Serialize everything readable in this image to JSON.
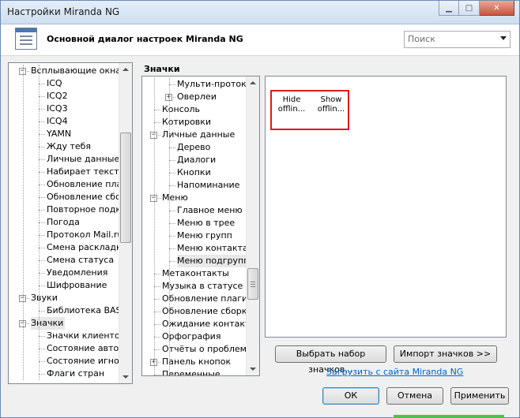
{
  "window": {
    "title": "Настройки Miranda NG"
  },
  "header": {
    "title": "Основной диалог настроек Miranda NG",
    "search_placeholder": "Поиск"
  },
  "left_tree": {
    "items": [
      {
        "label": "Всплывающие окна",
        "level": 0,
        "expander": "−"
      },
      {
        "label": "ICQ",
        "level": 1
      },
      {
        "label": "ICQ2",
        "level": 1
      },
      {
        "label": "ICQ3",
        "level": 1
      },
      {
        "label": "ICQ4",
        "level": 1
      },
      {
        "label": "YAMN",
        "level": 1
      },
      {
        "label": "Жду тебя",
        "level": 1
      },
      {
        "label": "Личные данные",
        "level": 1
      },
      {
        "label": "Набирает текст",
        "level": 1
      },
      {
        "label": "Обновление плагинов",
        "level": 1
      },
      {
        "label": "Обновление сборки",
        "level": 1
      },
      {
        "label": "Повторное подключение",
        "level": 1
      },
      {
        "label": "Погода",
        "level": 1
      },
      {
        "label": "Протокол Mail.ru Агент",
        "level": 1
      },
      {
        "label": "Смена раскладки",
        "level": 1
      },
      {
        "label": "Смена статуса",
        "level": 1
      },
      {
        "label": "Уведомления",
        "level": 1
      },
      {
        "label": "Шифрование",
        "level": 1
      },
      {
        "label": "Звуки",
        "level": 0,
        "expander": "−"
      },
      {
        "label": "Библиотека BASS",
        "level": 1
      },
      {
        "label": "Значки",
        "level": 0,
        "expander": "−",
        "selected": true
      },
      {
        "label": "Значки клиентов",
        "level": 1
      },
      {
        "label": "Состояние авторизации",
        "level": 1
      },
      {
        "label": "Состояние игнорирования",
        "level": 1
      },
      {
        "label": "Флаги стран",
        "level": 1
      }
    ]
  },
  "section": {
    "title": "Значки"
  },
  "middle_tree": {
    "items": [
      {
        "label": "Мульти-протоколы",
        "level": 1
      },
      {
        "label": "Оверлеи",
        "level": 1,
        "expander": "+"
      },
      {
        "label": "Консоль",
        "level": 0
      },
      {
        "label": "Котировки",
        "level": 0
      },
      {
        "label": "Личные данные",
        "level": 0,
        "expander": "−"
      },
      {
        "label": "Дерево",
        "level": 1
      },
      {
        "label": "Диалоги",
        "level": 1
      },
      {
        "label": "Кнопки",
        "level": 1
      },
      {
        "label": "Напоминание",
        "level": 1
      },
      {
        "label": "Меню",
        "level": 0,
        "expander": "−"
      },
      {
        "label": "Главное меню",
        "level": 1
      },
      {
        "label": "Меню в трее",
        "level": 1
      },
      {
        "label": "Меню групп",
        "level": 1
      },
      {
        "label": "Меню контакта",
        "level": 1
      },
      {
        "label": "Меню подгрупп",
        "level": 1,
        "selected": true
      },
      {
        "label": "Метаконтакты",
        "level": 0
      },
      {
        "label": "Музыка в статусе",
        "level": 0
      },
      {
        "label": "Обновление плагинов",
        "level": 0
      },
      {
        "label": "Обновление сборки",
        "level": 0
      },
      {
        "label": "Ожидание контактов",
        "level": 0
      },
      {
        "label": "Орфография",
        "level": 0
      },
      {
        "label": "Отчёты о проблемах",
        "level": 0
      },
      {
        "label": "Панель кнопок",
        "level": 0,
        "expander": "+"
      },
      {
        "label": "Переменные",
        "level": 0
      }
    ]
  },
  "icons": [
    {
      "label": "Hide offlin...",
      "icon": "hide-offline-icon"
    },
    {
      "label": "Show offlin...",
      "icon": "show-offline-icon"
    }
  ],
  "buttons": {
    "choose_set": "Выбрать набор значков...",
    "import": "Импорт значков >>",
    "download_link": "Загрузить с сайта Miranda NG",
    "ok": "ОК",
    "cancel": "Отмена",
    "apply": "Применить"
  },
  "colors": {
    "link": "#0066cc",
    "highlight": "#e01818",
    "title_gradient": "#cfdff0"
  }
}
